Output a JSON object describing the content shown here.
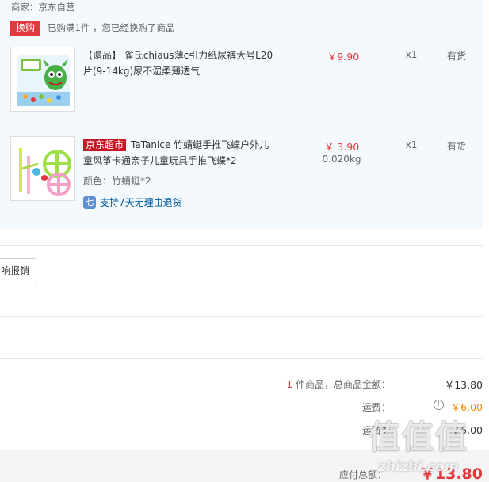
{
  "merchant": {
    "label": "商家：京东自营"
  },
  "swap": {
    "tag": "换购",
    "text": "已购满1件 ，您已经换购了商品"
  },
  "items": [
    {
      "name": "【赠品】 雀氏chiaus薄c引力纸尿裤大号L20片(9-14kg)尿不湿柔薄透气",
      "price": "￥9.90",
      "qty": "x1",
      "stock": "有货",
      "image": "diaper-package"
    },
    {
      "tag": "京东超市",
      "name": "TaTanice 竹蜻蜓手推飞蝶户外儿童风筝卡通亲子儿童玩具手推飞蝶*2",
      "price": "￥ 3.90",
      "weight": "0.020kg",
      "qty": "x1",
      "stock": "有货",
      "color": "颜色：竹蜻蜓*2",
      "return_icon": "七",
      "return_text": "支持7天无理由退货",
      "image": "bamboo-dragonfly-toy"
    }
  ],
  "report_button": "响报销",
  "summary": {
    "count": "1",
    "goods_label": " 件商品，总商品金额：",
    "goods_total": "￥13.80",
    "shipping_label": "运费：",
    "shipping_value": "￥6.00",
    "shipping_discount_label": "运费券",
    "shipping_discount_value": "￥6.00",
    "info_icon": "!",
    "payable_label": "应付总额：",
    "payable_value": "￥13.80"
  },
  "watermark": {
    "chars": "值值值",
    "url": "zhizhi.com"
  },
  "colors": {
    "price_red": "#e4393c",
    "jd_red": "#c81623",
    "link_blue": "#005aa0",
    "panel_bg": "#f3f9fd"
  }
}
